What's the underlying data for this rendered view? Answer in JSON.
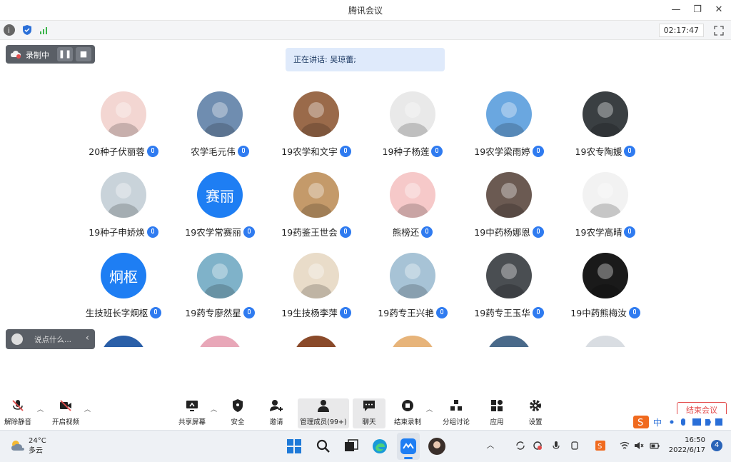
{
  "window": {
    "title": "腾讯会议",
    "minimize": "—",
    "restore": "❐",
    "close": "✕"
  },
  "status": {
    "timer": "02:17:47"
  },
  "recording": {
    "label": "录制中",
    "pause": "❚❚",
    "stop": "■"
  },
  "speaking": {
    "text": "正在讲话: 吴琼蕾;"
  },
  "participants": [
    {
      "name": "20种子伏丽蓉",
      "avatar_color": "#f3d6d2"
    },
    {
      "name": "农学毛元伟",
      "avatar_color": "#6f8db0"
    },
    {
      "name": "19农学和文宇",
      "avatar_color": "#9a6a4a"
    },
    {
      "name": "19种子杨莲",
      "avatar_color": "#e9e9e9"
    },
    {
      "name": "19农学梁雨婷",
      "avatar_color": "#6aa7e0"
    },
    {
      "name": "19农专陶媛",
      "avatar_color": "#3a3f42"
    },
    {
      "name": "19种子申娇焕",
      "avatar_color": "#c9d3da"
    },
    {
      "name": "19农学常赛丽",
      "avatar_text": "赛丽"
    },
    {
      "name": "19药鉴王世会",
      "avatar_color": "#c49a6a"
    },
    {
      "name": "熊榜还",
      "avatar_color": "#f6c9c9"
    },
    {
      "name": "19中药杨娜恩",
      "avatar_color": "#6b5a52"
    },
    {
      "name": "19农学高晴",
      "avatar_color": "#f2f2f2"
    },
    {
      "name": "生技班长字炯枢",
      "avatar_text": "炯枢"
    },
    {
      "name": "19药专廖然星",
      "avatar_color": "#7fb2c9"
    },
    {
      "name": "19生技杨李萍",
      "avatar_color": "#e9dcc9"
    },
    {
      "name": "19药专王兴艳",
      "avatar_color": "#a7c3d6"
    },
    {
      "name": "19药专王玉华",
      "avatar_color": "#4a4e52"
    },
    {
      "name": "19中药熊梅汝",
      "avatar_color": "#1a1a1a"
    }
  ],
  "partial_row_colors": [
    "#2a5fa8",
    "#e8a7b8",
    "#8a4a2a",
    "#e7b47a",
    "#4a6a8a",
    "#d9dde2"
  ],
  "chat": {
    "placeholder": "说点什么...",
    "arrow": "‹"
  },
  "toolbar": {
    "unmute": "解除静音",
    "video": "开启视频",
    "share": "共享屏幕",
    "security": "安全",
    "invite": "邀请",
    "members": "管理成员(99+)",
    "chat": "聊天",
    "stop_record": "结束录制",
    "breakout": "分组讨论",
    "apps": "应用",
    "settings": "设置",
    "end": "结束会议"
  },
  "taskbar": {
    "temp": "24°C",
    "weather": "多云",
    "time": "16:50",
    "date": "2022/6/17",
    "notifications": "4",
    "ime_lang": "中"
  }
}
